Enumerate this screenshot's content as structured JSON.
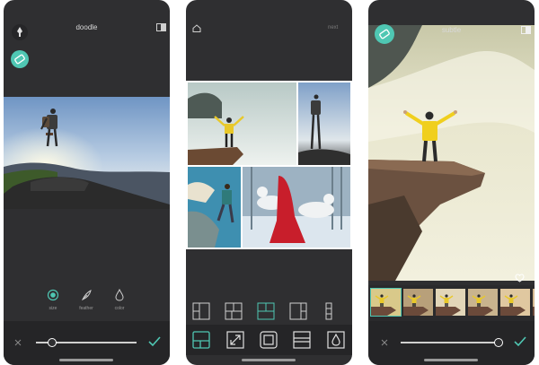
{
  "colors": {
    "accent": "#4fc7b3",
    "panel": "#2f2f31",
    "selected_layout": "#4fc7b3"
  },
  "screen1": {
    "title": "doodle",
    "tools": [
      {
        "icon": "pen-icon"
      },
      {
        "icon": "eraser-icon"
      }
    ],
    "brush_options": [
      {
        "label": "size",
        "icon": "size-dot-icon"
      },
      {
        "label": "feather",
        "icon": "feather-icon"
      },
      {
        "label": "color",
        "icon": "drop-icon"
      }
    ],
    "slider_level": 0.15
  },
  "screen2": {
    "next_label": "next",
    "layout_icons": [
      "layout-split-icon",
      "layout-grid-icon",
      "layout-selected-icon",
      "layout-columns-icon",
      "layout-strip-icon"
    ],
    "tool_icons": [
      "layout-tool-icon",
      "resize-icon",
      "border-icon",
      "spacing-icon",
      "background-icon"
    ]
  },
  "screen3": {
    "filter_name": "subtle",
    "slider_level": 0.96,
    "filter_count": 6
  }
}
